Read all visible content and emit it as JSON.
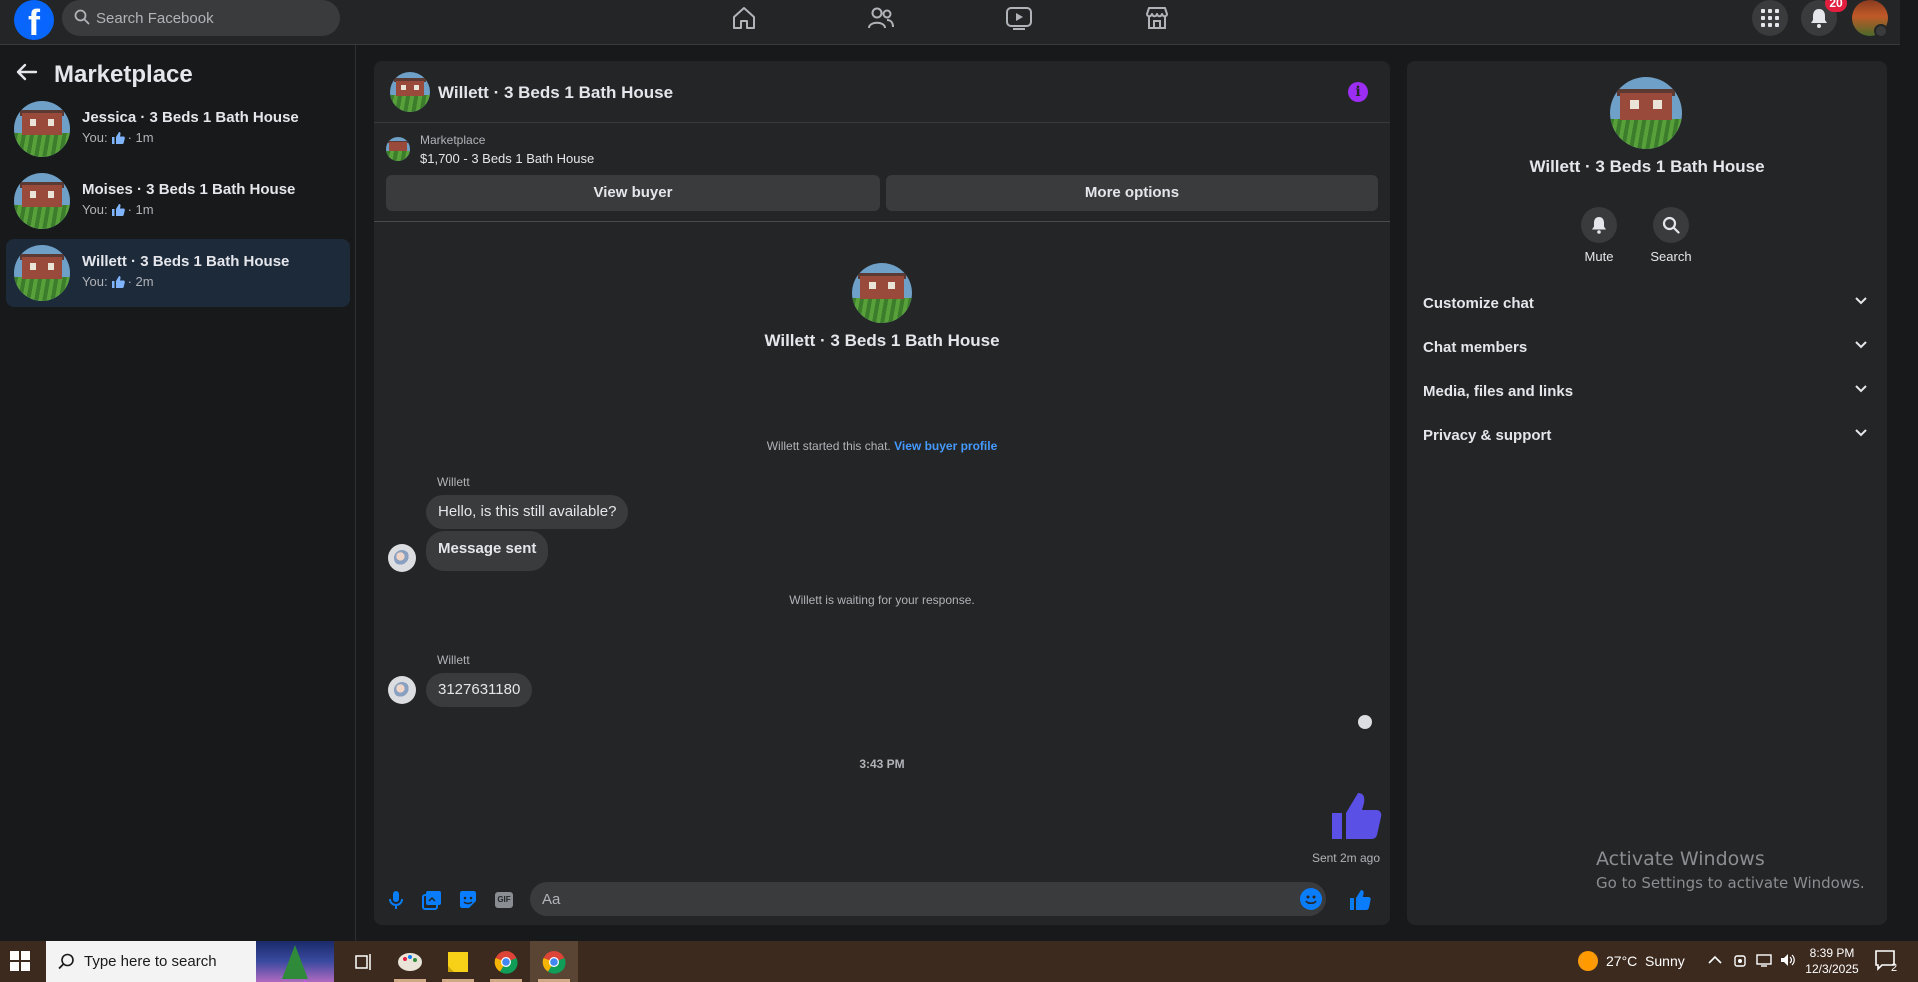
{
  "topbar": {
    "logo": "f",
    "search_placeholder": "Search Facebook",
    "nav_icons": [
      "home-icon",
      "friends-icon",
      "watch-icon",
      "marketplace-icon"
    ],
    "notification_count": "20"
  },
  "sidebar": {
    "title": "Marketplace",
    "conversations": [
      {
        "name": "Jessica · 3 Beds 1 Bath House",
        "prefix": "You:",
        "time": "· 1m"
      },
      {
        "name": "Moises · 3 Beds 1 Bath House",
        "prefix": "You:",
        "time": "· 1m"
      },
      {
        "name": "Willett · 3 Beds 1 Bath House",
        "prefix": "You:",
        "time": "· 2m"
      }
    ]
  },
  "chat": {
    "title": "Willett · 3 Beds 1 Bath House",
    "listing_source": "Marketplace",
    "listing_title": "$1,700 - 3 Beds 1 Bath House",
    "view_buyer_label": "View buyer",
    "more_options_label": "More options",
    "intro_title": "Willett · 3 Beds 1 Bath House",
    "started_text": "Willett started this chat.",
    "view_buyer_profile": "View buyer profile",
    "sender1": "Willett",
    "message1": "Hello, is this still available?",
    "message2": "Message sent",
    "waiting_text": "Willett is waiting for your response.",
    "sender2": "Willett",
    "message3": "3127631180",
    "time_separator": "3:43 PM",
    "sent_status": "Sent 2m ago",
    "composer_placeholder": "Aa",
    "gif_label": "GIF"
  },
  "info": {
    "title": "Willett · 3 Beds 1 Bath House",
    "mute_label": "Mute",
    "search_label": "Search",
    "rows": [
      "Customize chat",
      "Chat members",
      "Media, files and links",
      "Privacy & support"
    ]
  },
  "watermark": {
    "line1": "Activate Windows",
    "line2": "Go to Settings to activate Windows."
  },
  "taskbar": {
    "search_placeholder": "Type here to search",
    "weather": "27°C  Sunny",
    "time": "8:39 PM",
    "date": "12/3/2025",
    "notification_count": "2"
  },
  "colors": {
    "accent_blue": "#0a7cff",
    "like_purple": "#5b50e6",
    "info_purple": "#9b2ef2",
    "active_conv": "#1d2a3a"
  }
}
